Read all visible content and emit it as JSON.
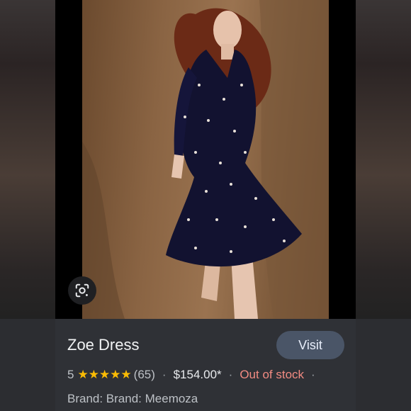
{
  "product": {
    "title": "Zoe Dress",
    "rating_value": "5",
    "stars": "★★★★★",
    "review_count": "(65)",
    "separator": "·",
    "price": "$154.00*",
    "availability": "Out of stock",
    "brand_line": "Brand: Brand: Meemoza"
  },
  "actions": {
    "visit_label": "Visit"
  },
  "icons": {
    "lens": "google-lens-icon"
  },
  "colors": {
    "star": "#fbbc04",
    "out_of_stock": "#f28b82",
    "visit_button": "#4a5567"
  }
}
